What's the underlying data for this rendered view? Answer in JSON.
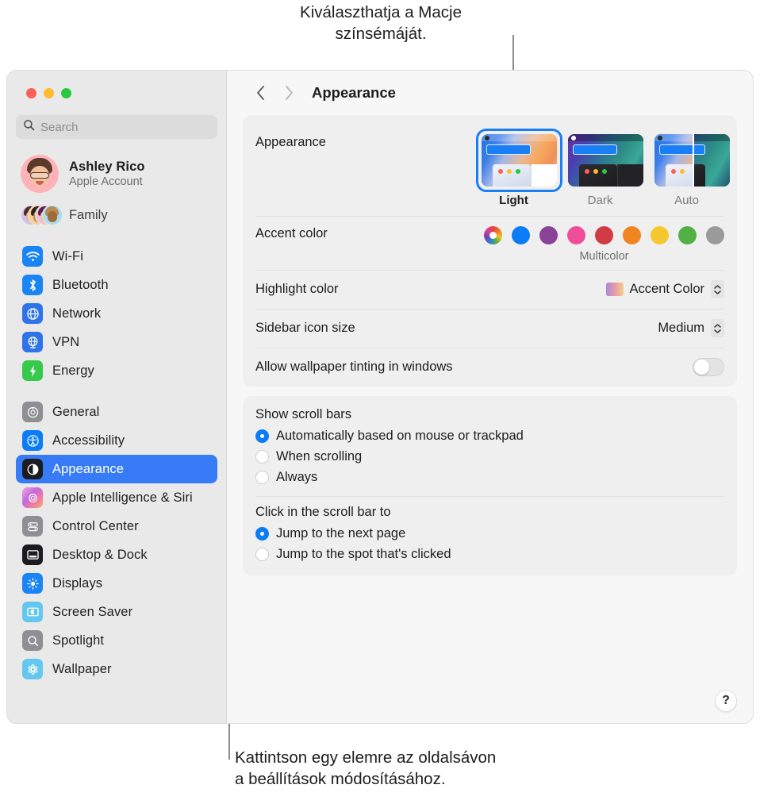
{
  "callouts": {
    "top": "Kiválaszthatja a Macje\nszínsémáját.",
    "bottom": "Kattintson egy elemre az oldalsávon\na beállítások módosításához."
  },
  "window": {
    "traffic_lights": [
      "close",
      "minimize",
      "zoom"
    ],
    "title": "Appearance"
  },
  "sidebar": {
    "search": {
      "placeholder": "Search",
      "value": ""
    },
    "account": {
      "name": "Ashley Rico",
      "subtitle": "Apple Account"
    },
    "family": {
      "label": "Family"
    },
    "groups": [
      {
        "items": [
          {
            "label": "Wi-Fi",
            "icon": "wifi-icon",
            "color": "#1a84f5"
          },
          {
            "label": "Bluetooth",
            "icon": "bluetooth-icon",
            "color": "#1a84f5"
          },
          {
            "label": "Network",
            "icon": "globe-icon",
            "color": "#2f73e8"
          },
          {
            "label": "VPN",
            "icon": "vpn-globe-icon",
            "color": "#2f73e8"
          },
          {
            "label": "Energy",
            "icon": "bolt-icon",
            "color": "#37c94c"
          }
        ]
      },
      {
        "items": [
          {
            "label": "General",
            "icon": "gear-icon",
            "color": "#8e8e93"
          },
          {
            "label": "Accessibility",
            "icon": "accessibility-icon",
            "color": "#0a7cf7"
          },
          {
            "label": "Appearance",
            "icon": "appearance-icon",
            "color": "#1c1c1e",
            "selected": true
          },
          {
            "label": "Apple Intelligence & Siri",
            "icon": "siri-icon",
            "color": "#e8608c"
          },
          {
            "label": "Control Center",
            "icon": "control-center-icon",
            "color": "#8e8e93"
          },
          {
            "label": "Desktop & Dock",
            "icon": "desktop-dock-icon",
            "color": "#1c1c1e"
          },
          {
            "label": "Displays",
            "icon": "displays-icon",
            "color": "#1a84f5"
          },
          {
            "label": "Screen Saver",
            "icon": "screen-saver-icon",
            "color": "#64c8ee"
          },
          {
            "label": "Spotlight",
            "icon": "spotlight-icon",
            "color": "#8e8e93"
          },
          {
            "label": "Wallpaper",
            "icon": "wallpaper-icon",
            "color": "#64c8ee"
          }
        ]
      }
    ]
  },
  "main": {
    "nav": {
      "back": "‹",
      "forward": "›"
    },
    "appearance": {
      "label": "Appearance",
      "modes": [
        {
          "label": "Light",
          "selected": true
        },
        {
          "label": "Dark",
          "selected": false
        },
        {
          "label": "Auto",
          "selected": false
        }
      ]
    },
    "accent": {
      "label": "Accent color",
      "selected_label": "Multicolor",
      "swatches": [
        {
          "name": "Multicolor",
          "color": "multicolor"
        },
        {
          "name": "Blue",
          "color": "#0a7cf7"
        },
        {
          "name": "Purple",
          "color": "#8b4299"
        },
        {
          "name": "Pink",
          "color": "#ef4e9b"
        },
        {
          "name": "Red",
          "color": "#d13b43"
        },
        {
          "name": "Orange",
          "color": "#ef8420"
        },
        {
          "name": "Yellow",
          "color": "#f7c82e"
        },
        {
          "name": "Green",
          "color": "#52b047"
        },
        {
          "name": "Graphite",
          "color": "#9a9a9a"
        }
      ]
    },
    "highlight": {
      "label": "Highlight color",
      "value": "Accent Color"
    },
    "sidebar_icon_size": {
      "label": "Sidebar icon size",
      "value": "Medium"
    },
    "wallpaper_tinting": {
      "label": "Allow wallpaper tinting in windows",
      "on": false
    },
    "scroll_bars": {
      "title": "Show scroll bars",
      "options": [
        {
          "label": "Automatically based on mouse or trackpad",
          "selected": true
        },
        {
          "label": "When scrolling",
          "selected": false
        },
        {
          "label": "Always",
          "selected": false
        }
      ]
    },
    "scroll_click": {
      "title": "Click in the scroll bar to",
      "options": [
        {
          "label": "Jump to the next page",
          "selected": true
        },
        {
          "label": "Jump to the spot that's clicked",
          "selected": false
        }
      ]
    },
    "help_label": "?"
  }
}
